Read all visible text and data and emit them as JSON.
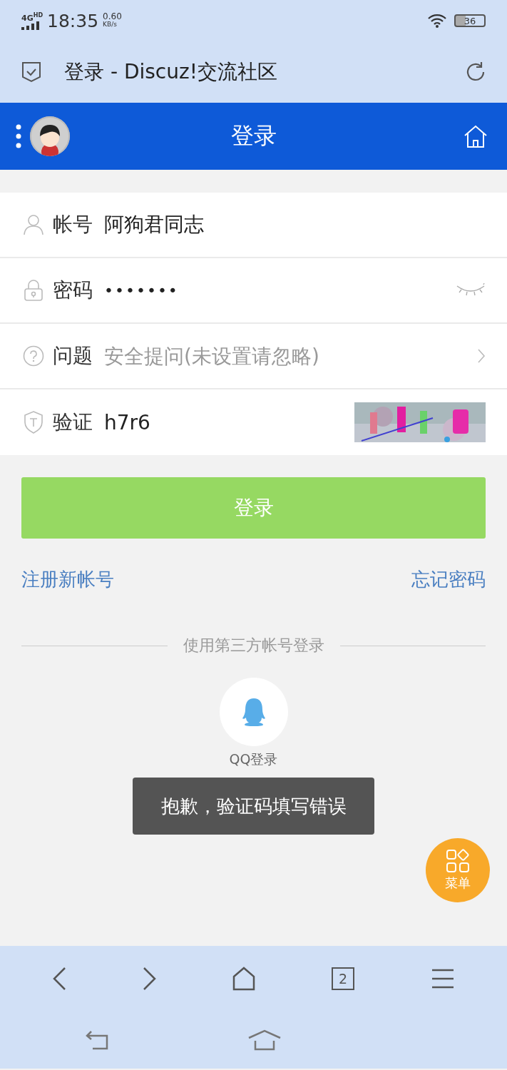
{
  "status_bar": {
    "network": "4G",
    "network_sup": "HD",
    "time": "18:35",
    "speed": "0.60",
    "speed_unit": "KB/s",
    "battery": "36"
  },
  "address_bar": {
    "title": "登录 - Discuz!交流社区"
  },
  "header": {
    "title": "登录"
  },
  "form": {
    "fields": [
      {
        "kind": "account",
        "label": "帐号",
        "value": "阿狗君同志"
      },
      {
        "kind": "password",
        "label": "密码",
        "value": "•••••••"
      },
      {
        "kind": "question",
        "label": "问题",
        "placeholder": "安全提问(未设置请忽略)"
      },
      {
        "kind": "captcha",
        "label": "验证",
        "value": "h7r6"
      }
    ]
  },
  "login_button": "登录",
  "register_link": "注册新帐号",
  "forgot_link": "忘记密码",
  "third_party": {
    "heading": "使用第三方帐号登录",
    "qq_label": "QQ登录"
  },
  "toast": "抱歉，验证码填写错误",
  "menu_button": "菜单",
  "browser_nav": {
    "tab_count": "2"
  }
}
